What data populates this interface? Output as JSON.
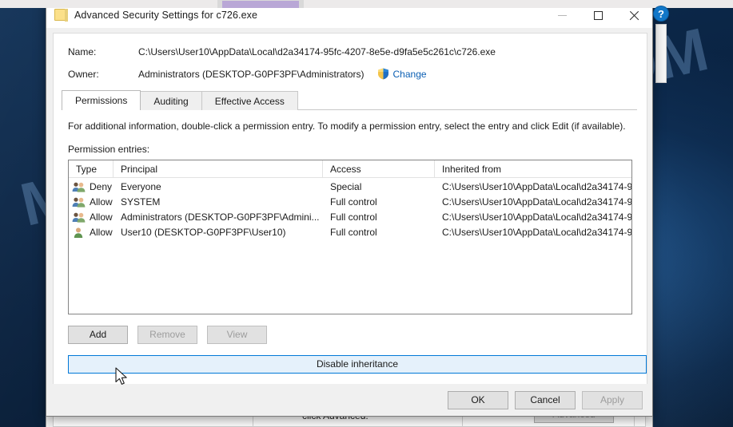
{
  "window": {
    "title": "Advanced Security Settings for c726.exe",
    "icon": "folder-icon",
    "controls": {
      "minimize": "minimize-icon",
      "maximize": "maximize-icon",
      "close": "close-icon"
    }
  },
  "help_button": {
    "label": "?"
  },
  "fields": {
    "name_label": "Name:",
    "name_value": "C:\\Users\\User10\\AppData\\Local\\d2a34174-95fc-4207-8e5e-d9fa5e5c261c\\c726.exe",
    "owner_label": "Owner:",
    "owner_value": "Administrators (DESKTOP-G0PF3PF\\Administrators)",
    "change_link": "Change",
    "change_icon": "uac-shield-icon"
  },
  "tabs": [
    {
      "label": "Permissions",
      "active": true
    },
    {
      "label": "Auditing",
      "active": false
    },
    {
      "label": "Effective Access",
      "active": false
    }
  ],
  "info_text": "For additional information, double-click a permission entry. To modify a permission entry, select the entry and click Edit (if available).",
  "entries_label": "Permission entries:",
  "table": {
    "columns": [
      "Type",
      "Principal",
      "Access",
      "Inherited from"
    ],
    "rows": [
      {
        "icon": "group-users-icon",
        "type": "Deny",
        "principal": "Everyone",
        "access": "Special",
        "inherited_from": "C:\\Users\\User10\\AppData\\Local\\d2a34174-9..."
      },
      {
        "icon": "group-users-icon",
        "type": "Allow",
        "principal": "SYSTEM",
        "access": "Full control",
        "inherited_from": "C:\\Users\\User10\\AppData\\Local\\d2a34174-9..."
      },
      {
        "icon": "group-users-icon",
        "type": "Allow",
        "principal": "Administrators (DESKTOP-G0PF3PF\\Admini...",
        "access": "Full control",
        "inherited_from": "C:\\Users\\User10\\AppData\\Local\\d2a34174-9..."
      },
      {
        "icon": "single-user-icon",
        "type": "Allow",
        "principal": "User10 (DESKTOP-G0PF3PF\\User10)",
        "access": "Full control",
        "inherited_from": "C:\\Users\\User10\\AppData\\Local\\d2a34174-9..."
      }
    ]
  },
  "buttons": {
    "add": {
      "label": "Add",
      "enabled": true
    },
    "remove": {
      "label": "Remove",
      "enabled": false
    },
    "view": {
      "label": "View",
      "enabled": false
    },
    "disable_inheritance": {
      "label": "Disable inheritance",
      "enabled": true,
      "hovered": true
    }
  },
  "footer": {
    "ok": {
      "label": "OK",
      "enabled": true
    },
    "cancel": {
      "label": "Cancel",
      "enabled": true
    },
    "apply": {
      "label": "Apply",
      "enabled": false
    }
  },
  "background_dialog": {
    "text": "click Advanced.",
    "advanced_button": "Advanced"
  },
  "watermark": "MYANTISPYWARE.COM",
  "colors": {
    "accent": "#0078d7",
    "link": "#0b5fb3",
    "desktop": "#0a2342",
    "window_bg": "#f0f0f0",
    "titlebar": "#ffffff",
    "watermark": "#96c3f5"
  }
}
